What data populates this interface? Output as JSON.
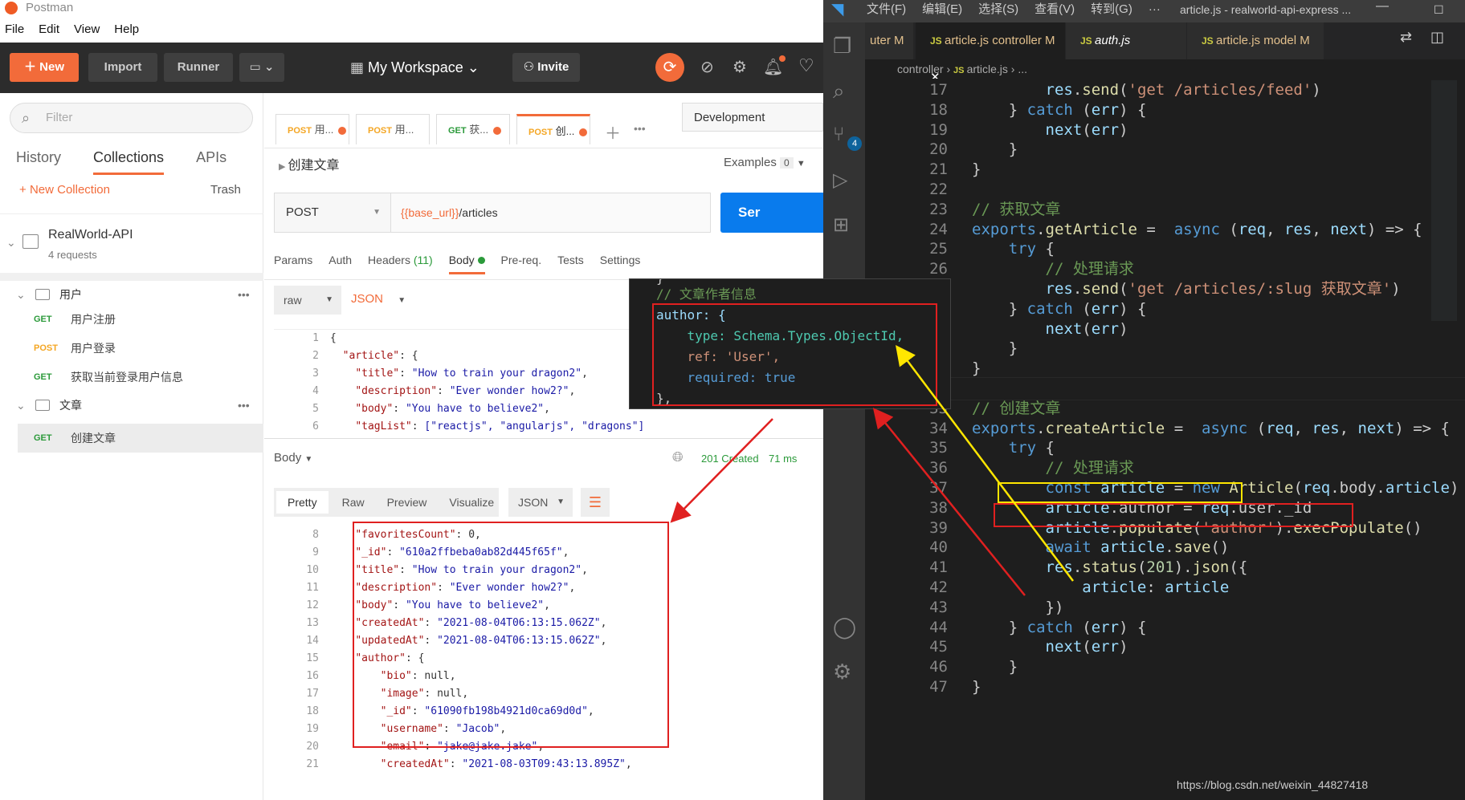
{
  "postman": {
    "title": "Postman",
    "menu": [
      "File",
      "Edit",
      "View",
      "Help"
    ],
    "toolbar": {
      "new": "New",
      "import": "Import",
      "runner": "Runner",
      "workspace": "My Workspace",
      "invite": "Invite"
    },
    "sidebar": {
      "filter_placeholder": "Filter",
      "tabs": [
        "History",
        "Collections",
        "APIs"
      ],
      "new_collection": "New Collection",
      "trash": "Trash",
      "collection": {
        "name": "RealWorld-API",
        "count": "4 requests"
      },
      "folders": [
        {
          "name": "用户",
          "items": [
            {
              "method": "GET",
              "name": "用户注册"
            },
            {
              "method": "POST",
              "name": "用户登录"
            },
            {
              "method": "GET",
              "name": "获取当前登录用户信息"
            }
          ]
        },
        {
          "name": "文章",
          "items": [
            {
              "method": "GET",
              "name": "创建文章"
            }
          ]
        }
      ]
    },
    "req_tabs": [
      {
        "method": "POST",
        "name": "用..."
      },
      {
        "method": "POST",
        "name": "用..."
      },
      {
        "method": "GET",
        "name": "获..."
      },
      {
        "method": "POST",
        "name": "创..."
      }
    ],
    "environment": "Development",
    "request": {
      "name": "创建文章",
      "examples_label": "Examples",
      "examples_count": "0",
      "method": "POST",
      "url_var": "{{base_url}}",
      "url_path": "/articles",
      "send": "Ser"
    },
    "req_subtabs": [
      "Params",
      "Auth",
      "Headers",
      "(11)",
      "Body",
      "Pre-req.",
      "Tests",
      "Settings"
    ],
    "body_mode": {
      "raw": "raw",
      "type": "JSON"
    },
    "req_body": [
      {
        "n": "1",
        "t": "{"
      },
      {
        "n": "2",
        "t": "  \"article\": {"
      },
      {
        "n": "3",
        "t": "    \"title\": \"How to train your dragon2\","
      },
      {
        "n": "4",
        "t": "    \"description\": \"Ever wonder how2?\","
      },
      {
        "n": "5",
        "t": "    \"body\": \"You have to believe2\","
      },
      {
        "n": "6",
        "t": "    \"tagList\": [\"reactjs\", \"angularjs\", \"dragons\"]"
      }
    ],
    "response": {
      "label": "Body",
      "status": "201 Created",
      "time": "71 ms",
      "views": [
        "Pretty",
        "Raw",
        "Preview",
        "Visualize"
      ],
      "format": "JSON"
    },
    "res_body": [
      {
        "n": "8",
        "t": "    \"favoritesCount\": 0,"
      },
      {
        "n": "9",
        "t": "    \"_id\": \"610a2ffbeba0ab82d445f65f\","
      },
      {
        "n": "10",
        "t": "    \"title\": \"How to train your dragon2\","
      },
      {
        "n": "11",
        "t": "    \"description\": \"Ever wonder how2?\","
      },
      {
        "n": "12",
        "t": "    \"body\": \"You have to believe2\","
      },
      {
        "n": "13",
        "t": "    \"createdAt\": \"2021-08-04T06:13:15.062Z\","
      },
      {
        "n": "14",
        "t": "    \"updatedAt\": \"2021-08-04T06:13:15.062Z\","
      },
      {
        "n": "15",
        "t": "    \"author\": {"
      },
      {
        "n": "16",
        "t": "        \"bio\": null,"
      },
      {
        "n": "17",
        "t": "        \"image\": null,"
      },
      {
        "n": "18",
        "t": "        \"_id\": \"61090fb198b4921d0ca69d0d\","
      },
      {
        "n": "19",
        "t": "        \"username\": \"Jacob\","
      },
      {
        "n": "20",
        "t": "        \"email\": \"jake@jake.jake\","
      },
      {
        "n": "21",
        "t": "        \"createdAt\": \"2021-08-03T09:43:13.895Z\","
      }
    ]
  },
  "vscode": {
    "menu": [
      "文件(F)",
      "编辑(E)",
      "选择(S)",
      "查看(V)",
      "转到(G)",
      "···"
    ],
    "title": "article.js - realworld-api-express ...",
    "tabs": [
      {
        "label": "uter M"
      },
      {
        "label": "article.js controller M",
        "active": true
      },
      {
        "label": "auth.js"
      },
      {
        "label": "article.js model M"
      }
    ],
    "breadcrumb": [
      "controller",
      "article.js",
      "..."
    ],
    "scm_badge": "4",
    "lines": [
      {
        "n": "17",
        "t": "        res.send('get /articles/feed')"
      },
      {
        "n": "18",
        "t": "    } catch (err) {"
      },
      {
        "n": "19",
        "t": "        next(err)"
      },
      {
        "n": "20",
        "t": "    }"
      },
      {
        "n": "21",
        "t": "}"
      },
      {
        "n": "22",
        "t": ""
      },
      {
        "n": "23",
        "t": "// 获取文章"
      },
      {
        "n": "24",
        "t": "exports.getArticle =  async (req, res, next) => {"
      },
      {
        "n": "25",
        "t": "    try {"
      },
      {
        "n": "26",
        "t": "        // 处理请求"
      },
      {
        "n": "27",
        "t": "        res.send('get /articles/:slug 获取文章')"
      },
      {
        "n": "28",
        "t": "    } catch (err) {"
      },
      {
        "n": "29",
        "t": "        next(err)"
      },
      {
        "n": "30",
        "t": "    }"
      },
      {
        "n": "31",
        "t": "}"
      },
      {
        "n": "32",
        "t": ""
      },
      {
        "n": "33",
        "t": "// 创建文章"
      },
      {
        "n": "34",
        "t": "exports.createArticle =  async (req, res, next) => {"
      },
      {
        "n": "35",
        "t": "    try {"
      },
      {
        "n": "36",
        "t": "        // 处理请求"
      },
      {
        "n": "37",
        "t": "        const article = new Article(req.body.article)"
      },
      {
        "n": "38",
        "t": "        article.author = req.user._id"
      },
      {
        "n": "39",
        "t": "        article.populate('author').execPopulate()"
      },
      {
        "n": "40",
        "t": "        await article.save()"
      },
      {
        "n": "41",
        "t": "        res.status(201).json({"
      },
      {
        "n": "42",
        "t": "            article: article"
      },
      {
        "n": "43",
        "t": "        })"
      },
      {
        "n": "44",
        "t": "    } catch (err) {"
      },
      {
        "n": "45",
        "t": "        next(err)"
      },
      {
        "n": "46",
        "t": "    }"
      },
      {
        "n": "47",
        "t": "}"
      }
    ],
    "popup": [
      "}",
      "// 文章作者信息",
      "author: {",
      "    type: Schema.Types.ObjectId,",
      "    ref: 'User',",
      "    required: true",
      "},"
    ],
    "watermark": "https://blog.csdn.net/weixin_44827418"
  }
}
